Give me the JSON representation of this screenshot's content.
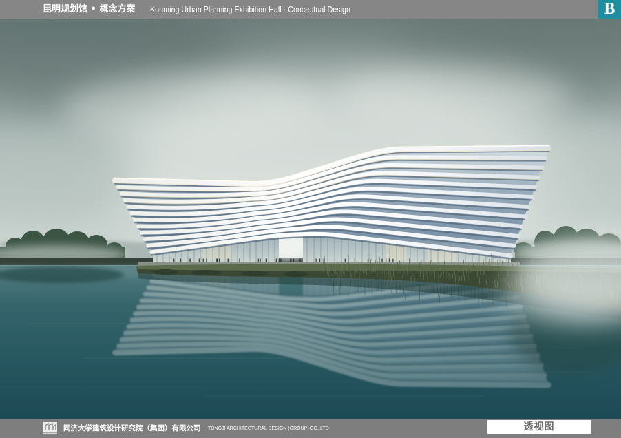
{
  "header": {
    "title_cn": "昆明规划馆 • 概念方案",
    "title_en": "Kunming Urban Planning Exhibition Hall · Conceptual Design",
    "sheet_badge": "B"
  },
  "footer": {
    "company_cn": "同济大学建筑设计研究院（集团）有限公司",
    "company_en": "TONGJI ARCHITECTURAL DESIGN (GROUP) CO.,LTD",
    "view_label": "透视图"
  },
  "icons": {
    "logo": "tongji-logo-icon"
  },
  "colors": {
    "header_bar": "#868686",
    "footer_bar": "#7e7e7e",
    "badge": "#1e8fa1",
    "label_text": "#6d6d6d"
  }
}
